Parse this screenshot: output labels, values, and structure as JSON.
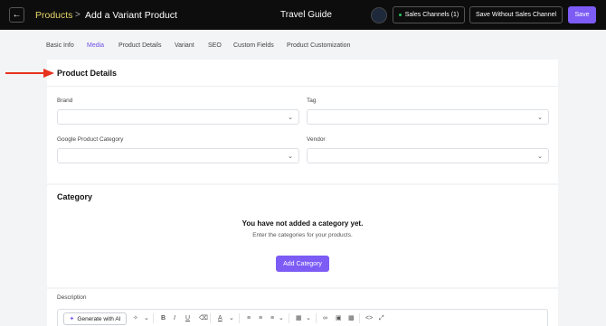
{
  "header": {
    "breadcrumb_root": "Products",
    "breadcrumb_separator": ">",
    "page_title": "Add a Variant Product",
    "store_name": "Travel Guide",
    "sales_channels_label": "Sales Channels (1)",
    "save_without_label": "Save Without Sales Channel",
    "save_label": "Save"
  },
  "tabs": [
    {
      "label": "Basic Info",
      "active": false
    },
    {
      "label": "Media",
      "active": true
    },
    {
      "label": "Product Details",
      "active": false
    },
    {
      "label": "Variant",
      "active": false
    },
    {
      "label": "SEO",
      "active": false
    },
    {
      "label": "Custom Fields",
      "active": false
    },
    {
      "label": "Product Customization",
      "active": false
    }
  ],
  "product_details": {
    "title": "Product Details",
    "brand_label": "Brand",
    "tag_label": "Tag",
    "google_category_label": "Google Product Category",
    "vendor_label": "Vendor"
  },
  "category": {
    "title": "Category",
    "empty_title": "You have not added a category yet.",
    "empty_subtitle": "Enter the categories for your products.",
    "add_button": "Add Category"
  },
  "description": {
    "label": "Description",
    "generate_ai_label": "Generate with AI"
  },
  "colors": {
    "accent": "#7c5cf5",
    "breadcrumb": "#e7d66b",
    "arrow": "#e8321e",
    "topbar": "#0d0d0d"
  },
  "icons": {
    "back": "arrow-left",
    "select": "chevron-down",
    "ai": "sparkle",
    "toolbar": [
      "magic-wand",
      "bold",
      "italic",
      "underline",
      "eraser",
      "text-color",
      "bullet-list",
      "numbered-list",
      "align",
      "table",
      "link",
      "image",
      "video",
      "code",
      "fullscreen"
    ]
  }
}
